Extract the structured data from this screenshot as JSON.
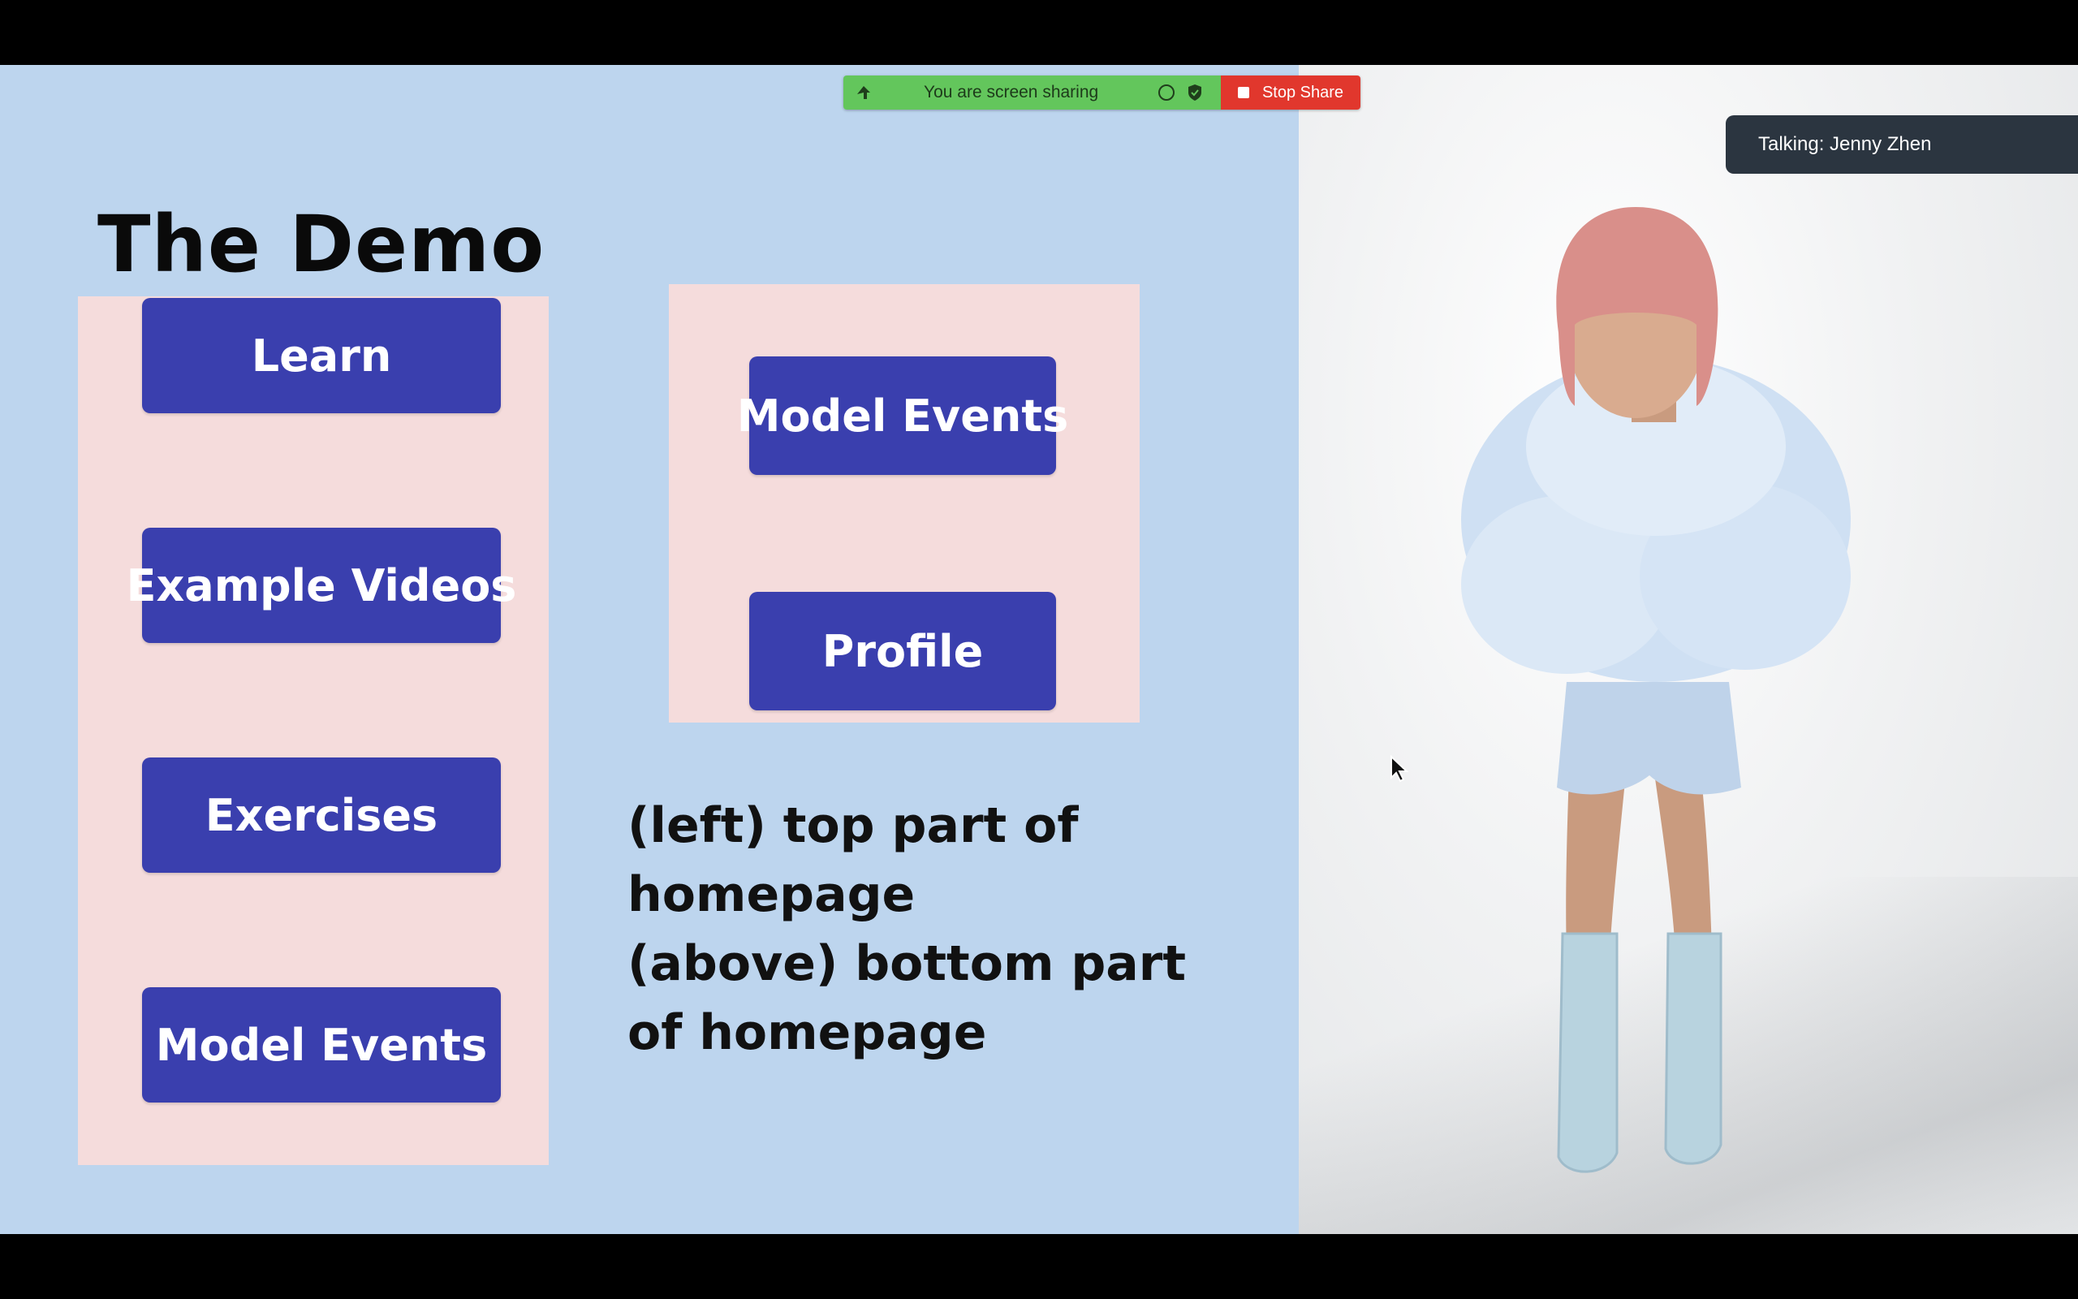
{
  "share_bar": {
    "status_text": "You are screen sharing",
    "stop_label": "Stop Share"
  },
  "slide": {
    "title": "The Demo",
    "left_panel_buttons": [
      {
        "label": "Learn"
      },
      {
        "label": "Example Videos"
      },
      {
        "label": "Exercises"
      },
      {
        "label": "Model Events"
      }
    ],
    "right_panel_buttons": [
      {
        "label": "Model Events"
      },
      {
        "label": "Profile"
      }
    ],
    "caption_lines": [
      "(left) top part of",
      "homepage",
      "(above) bottom part",
      "of homepage"
    ],
    "colors": {
      "background": "#bdd5ee",
      "panel": "#f5dcdc",
      "button": "#3a3fae"
    }
  },
  "video": {
    "talking_label": "Talking: Jenny Zhen"
  }
}
